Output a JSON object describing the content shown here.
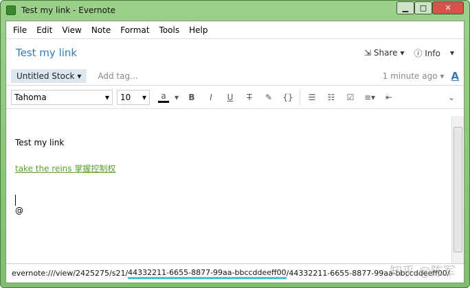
{
  "window": {
    "title": "Test my link - Evernote"
  },
  "menu": [
    "File",
    "Edit",
    "View",
    "Note",
    "Format",
    "Tools",
    "Help"
  ],
  "header": {
    "title": "Test my link",
    "share": "Share",
    "info": "Info"
  },
  "tags": {
    "notebook": "Untitled Stock",
    "add_tag": "Add tag...",
    "updated": "1 minute ago"
  },
  "toolbar": {
    "font": "Tahoma",
    "size": "10"
  },
  "note": {
    "line1": "Test my link",
    "link": "take the reins 掌握控制权",
    "at": "@"
  },
  "status": {
    "prefix": "evernote:///view/2425275/s21/",
    "highlight": "44332211-6655-8877-99aa-bbccddeeff00",
    "suffix": "/44332211-6655-8877-99aa-bbccddeeff00/"
  },
  "watermark": "知乎 @陈军"
}
